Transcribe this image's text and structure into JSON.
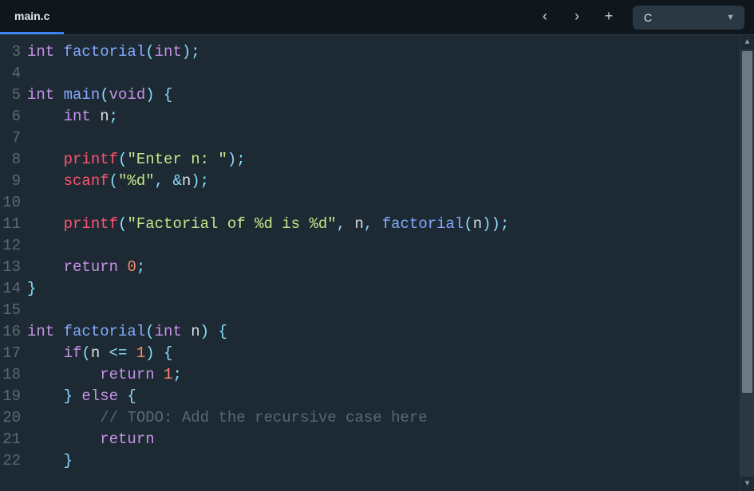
{
  "header": {
    "tab_label": "main.c",
    "language": "C"
  },
  "code": {
    "lines": [
      {
        "n": 3,
        "tokens": [
          [
            "type",
            "int "
          ],
          [
            "fn",
            "factorial"
          ],
          [
            "pun",
            "("
          ],
          [
            "type",
            "int"
          ],
          [
            "pun",
            ");"
          ]
        ]
      },
      {
        "n": 4,
        "tokens": []
      },
      {
        "n": 5,
        "tokens": [
          [
            "type",
            "int "
          ],
          [
            "fn",
            "main"
          ],
          [
            "pun",
            "("
          ],
          [
            "type",
            "void"
          ],
          [
            "pun",
            ") {"
          ]
        ]
      },
      {
        "n": 6,
        "tokens": [
          [
            "var",
            "    "
          ],
          [
            "type",
            "int "
          ],
          [
            "var",
            "n"
          ],
          [
            "pun",
            ";"
          ]
        ]
      },
      {
        "n": 7,
        "tokens": []
      },
      {
        "n": 8,
        "tokens": [
          [
            "var",
            "    "
          ],
          [
            "fnc",
            "printf"
          ],
          [
            "pun",
            "("
          ],
          [
            "str",
            "\"Enter n: \""
          ],
          [
            "pun",
            ");"
          ]
        ]
      },
      {
        "n": 9,
        "tokens": [
          [
            "var",
            "    "
          ],
          [
            "fnc",
            "scanf"
          ],
          [
            "pun",
            "("
          ],
          [
            "str",
            "\"%d\""
          ],
          [
            "pun",
            ", "
          ],
          [
            "amp",
            "&"
          ],
          [
            "var",
            "n"
          ],
          [
            "pun",
            ");"
          ]
        ]
      },
      {
        "n": 10,
        "tokens": []
      },
      {
        "n": 11,
        "tokens": [
          [
            "var",
            "    "
          ],
          [
            "fnc",
            "printf"
          ],
          [
            "pun",
            "("
          ],
          [
            "str",
            "\"Factorial of %d is %d\""
          ],
          [
            "pun",
            ", "
          ],
          [
            "var",
            "n"
          ],
          [
            "pun",
            ", "
          ],
          [
            "fn",
            "factorial"
          ],
          [
            "pun",
            "("
          ],
          [
            "var",
            "n"
          ],
          [
            "pun",
            "));"
          ]
        ]
      },
      {
        "n": 12,
        "tokens": []
      },
      {
        "n": 13,
        "tokens": [
          [
            "var",
            "    "
          ],
          [
            "kw",
            "return "
          ],
          [
            "num",
            "0"
          ],
          [
            "pun",
            ";"
          ]
        ]
      },
      {
        "n": 14,
        "tokens": [
          [
            "pun",
            "}"
          ]
        ]
      },
      {
        "n": 15,
        "tokens": []
      },
      {
        "n": 16,
        "tokens": [
          [
            "type",
            "int "
          ],
          [
            "fn",
            "factorial"
          ],
          [
            "pun",
            "("
          ],
          [
            "type",
            "int "
          ],
          [
            "var",
            "n"
          ],
          [
            "pun",
            ") {"
          ]
        ]
      },
      {
        "n": 17,
        "tokens": [
          [
            "var",
            "    "
          ],
          [
            "kw",
            "if"
          ],
          [
            "pun",
            "("
          ],
          [
            "var",
            "n "
          ],
          [
            "op",
            "<="
          ],
          [
            "var",
            " "
          ],
          [
            "num",
            "1"
          ],
          [
            "pun",
            ") {"
          ]
        ]
      },
      {
        "n": 18,
        "tokens": [
          [
            "var",
            "        "
          ],
          [
            "kw",
            "return "
          ],
          [
            "num",
            "1"
          ],
          [
            "pun",
            ";"
          ]
        ]
      },
      {
        "n": 19,
        "tokens": [
          [
            "var",
            "    "
          ],
          [
            "pun",
            "} "
          ],
          [
            "kw",
            "else"
          ],
          [
            "pun",
            " {"
          ]
        ]
      },
      {
        "n": 20,
        "tokens": [
          [
            "var",
            "        "
          ],
          [
            "cmt",
            "// TODO: Add the recursive case here"
          ]
        ]
      },
      {
        "n": 21,
        "tokens": [
          [
            "var",
            "        "
          ],
          [
            "kw",
            "return"
          ]
        ]
      },
      {
        "n": 22,
        "tokens": [
          [
            "var",
            "    "
          ],
          [
            "pun",
            "}"
          ]
        ]
      }
    ]
  }
}
